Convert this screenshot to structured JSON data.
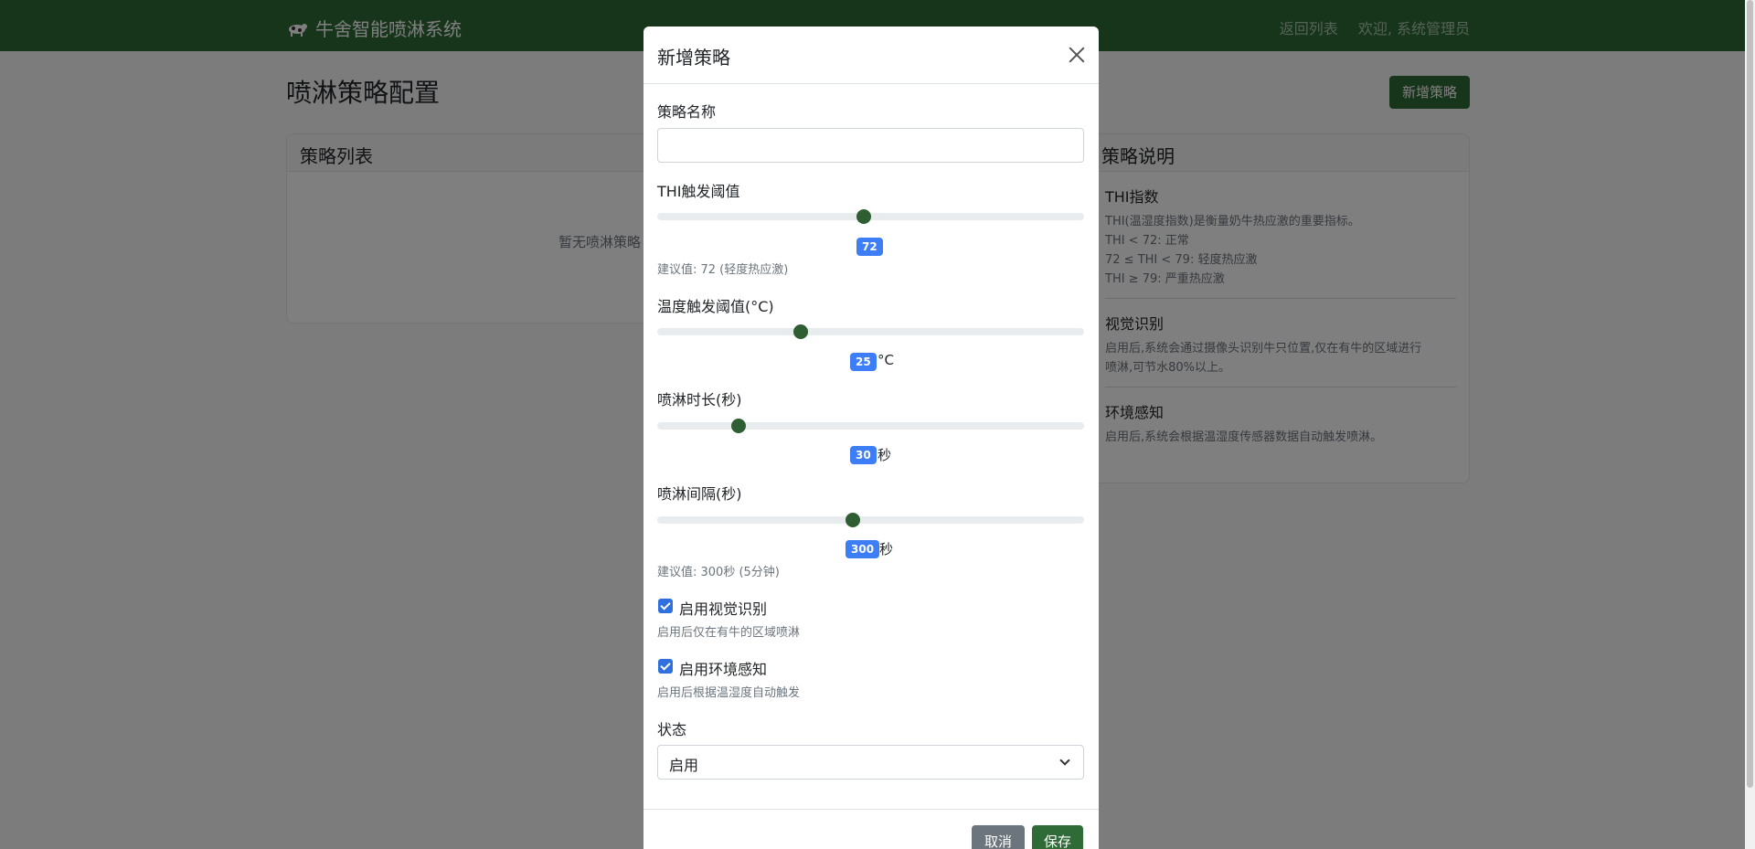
{
  "navbar": {
    "brand": "牛舍智能喷淋系统",
    "back_link": "返回列表",
    "welcome": "欢迎, 系统管理员"
  },
  "page": {
    "title": "喷淋策略配置",
    "add_button": "新增策略"
  },
  "strategy_list": {
    "header": "策略列表",
    "empty_text": "暂无喷淋策略"
  },
  "explanation": {
    "header": "策略说明",
    "sections": [
      {
        "title": "THI指数",
        "lines": [
          "THI(温湿度指数)是衡量奶牛热应激的重要指标。",
          "THI < 72: 正常",
          "72 ≤ THI < 79: 轻度热应激",
          "THI ≥ 79: 严重热应激"
        ]
      },
      {
        "title": "视觉识别",
        "lines": [
          "启用后,系统会通过摄像头识别牛只位置,仅在有牛的区域进行",
          "喷淋,可节水80%以上。"
        ]
      },
      {
        "title": "环境感知",
        "lines": [
          "启用后,系统会根据温湿度传感器数据自动触发喷淋。"
        ]
      }
    ]
  },
  "modal": {
    "title": "新增策略",
    "name_label": "策略名称",
    "name_value": "",
    "thi": {
      "label": "THI触发阈值",
      "value": "72",
      "unit": "",
      "hint": "建议值: 72 (轻度热应激)"
    },
    "temp": {
      "label": "温度触发阈值(°C)",
      "value": "25",
      "unit": "°C"
    },
    "duration": {
      "label": "喷淋时长(秒)",
      "value": "30",
      "unit": "秒"
    },
    "interval": {
      "label": "喷淋间隔(秒)",
      "value": "300",
      "unit": "秒",
      "hint": "建议值: 300秒 (5分钟)"
    },
    "vision": {
      "label": "启用视觉识别",
      "checked": true,
      "hint": "启用后仅在有牛的区域喷淋"
    },
    "env": {
      "label": "启用环境感知",
      "checked": true,
      "hint": "启用后根据温湿度自动触发"
    },
    "status": {
      "label": "状态",
      "value": "启用"
    },
    "cancel_button": "取消",
    "save_button": "保存"
  },
  "colors": {
    "navbar": "#2e6b36",
    "primary_green": "#2e6b36",
    "slider_thumb": "#2e5e31",
    "badge_blue": "#3d7ef6",
    "checkbox_blue": "#2f6fde"
  }
}
